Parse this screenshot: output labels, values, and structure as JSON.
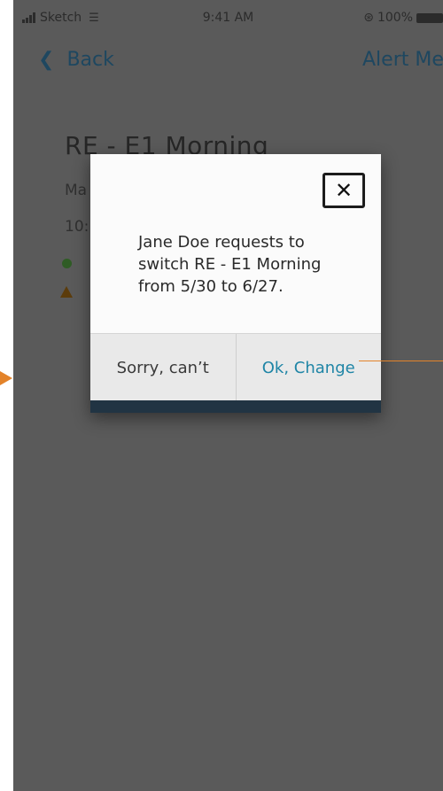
{
  "status_bar": {
    "carrier": "Sketch",
    "time": "9:41 AM",
    "battery": "100%"
  },
  "nav": {
    "back_label": "Back",
    "alert_label": "Alert Me"
  },
  "background": {
    "title": "RE -  E1 Morning",
    "line1": "Ma",
    "line2": "10:"
  },
  "modal": {
    "message": "Jane Doe requests to switch RE - E1 Morning from 5/30 to 6/27.",
    "cancel_label": "Sorry, can’t",
    "confirm_label": "Ok, Change"
  },
  "colors": {
    "overlay": "#5a5a5a",
    "accent": "#1f85a6",
    "annotation": "#e3832a",
    "footer": "#213443"
  }
}
